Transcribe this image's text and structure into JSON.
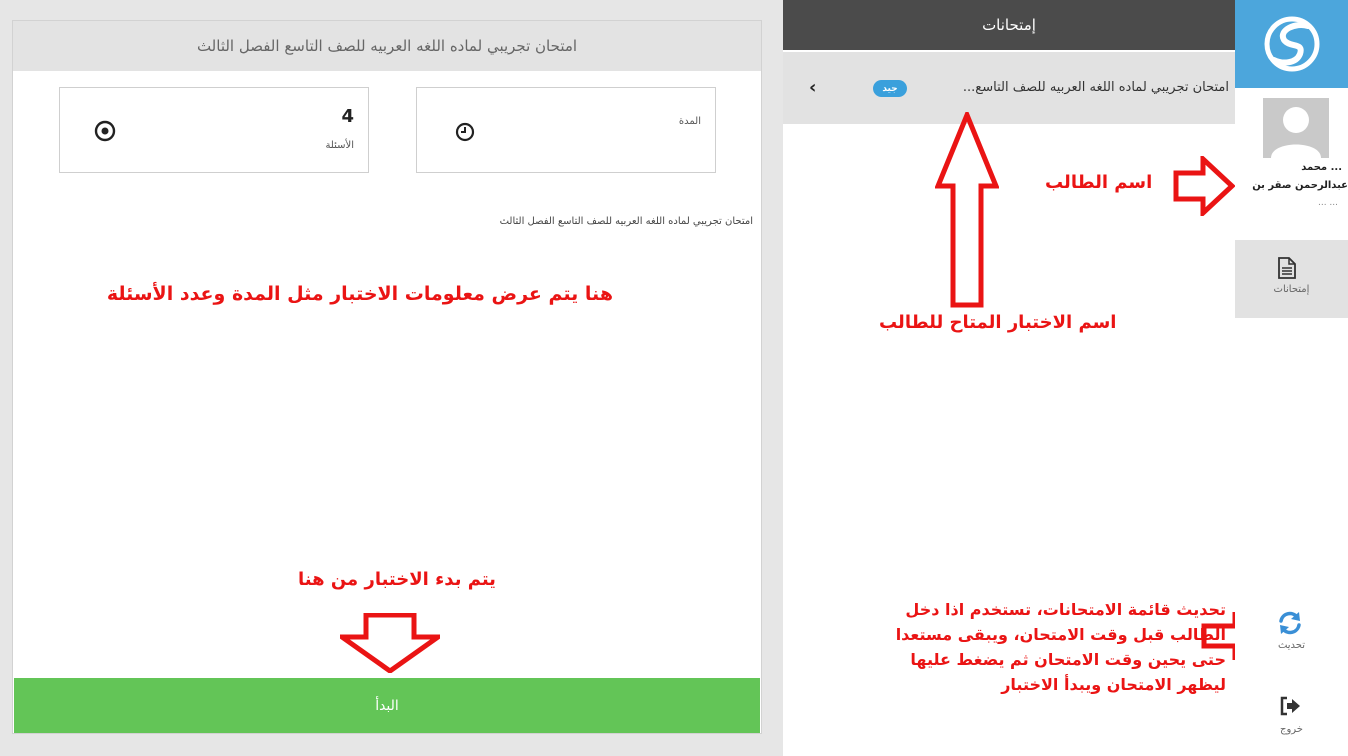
{
  "exam": {
    "header_title": "امتحان تجريبي لماده اللغه العربيه للصف التاسع الفصل الثالث",
    "duration_label": "المدة",
    "questions_value": "4",
    "questions_label": "الأسئلة",
    "description": "امتحان تجريبي لماده اللغه العربيه للصف التاسع الفصل الثالث",
    "start_label": "البدأ"
  },
  "exam_list": {
    "header": "إمتحانات",
    "items": [
      {
        "title": "امتحان تجريبي لماده اللغه العربيه للصف التاسع...",
        "badge": "جيد"
      }
    ]
  },
  "sidebar": {
    "student": {
      "line1": "... محمد",
      "line2": "عبدالرحمن صقر بن",
      "line3": "... ..."
    },
    "nav": {
      "exams_label": "إمتحانات",
      "refresh_label": "تحديث",
      "logout_label": "خروج"
    }
  },
  "annotations": {
    "info_note": "هنا يتم عرض معلومات الاختبار مثل المدة وعدد الأسئلة",
    "start_note": "يتم بدء الاختبار من هنا",
    "exam_name_note": "اسم الاختبار المتاح للطالب",
    "student_name_note": "اسم الطالب",
    "refresh_note_lines": [
      "تحديث قائمة الامتحانات، تستخدم اذا دخل",
      "الطالب قبل وقت الامتحان، ويبقى مستعدا",
      "حتى يحين وقت الامتحان ثم يضغط عليها",
      "ليظهر الامتحان ويبدأ الاختبار"
    ]
  },
  "colors": {
    "start_button": "#63c557",
    "logo_bg": "#4ca6dc",
    "badge": "#3aa0dc",
    "annotation": "#ea1414",
    "list_header": "#4b4b4b"
  },
  "icons": {
    "duration": "clock-icon",
    "questions": "target-icon",
    "exams": "document-icon",
    "refresh": "refresh-icon",
    "logout": "logout-icon",
    "logo": "logo-icon"
  }
}
